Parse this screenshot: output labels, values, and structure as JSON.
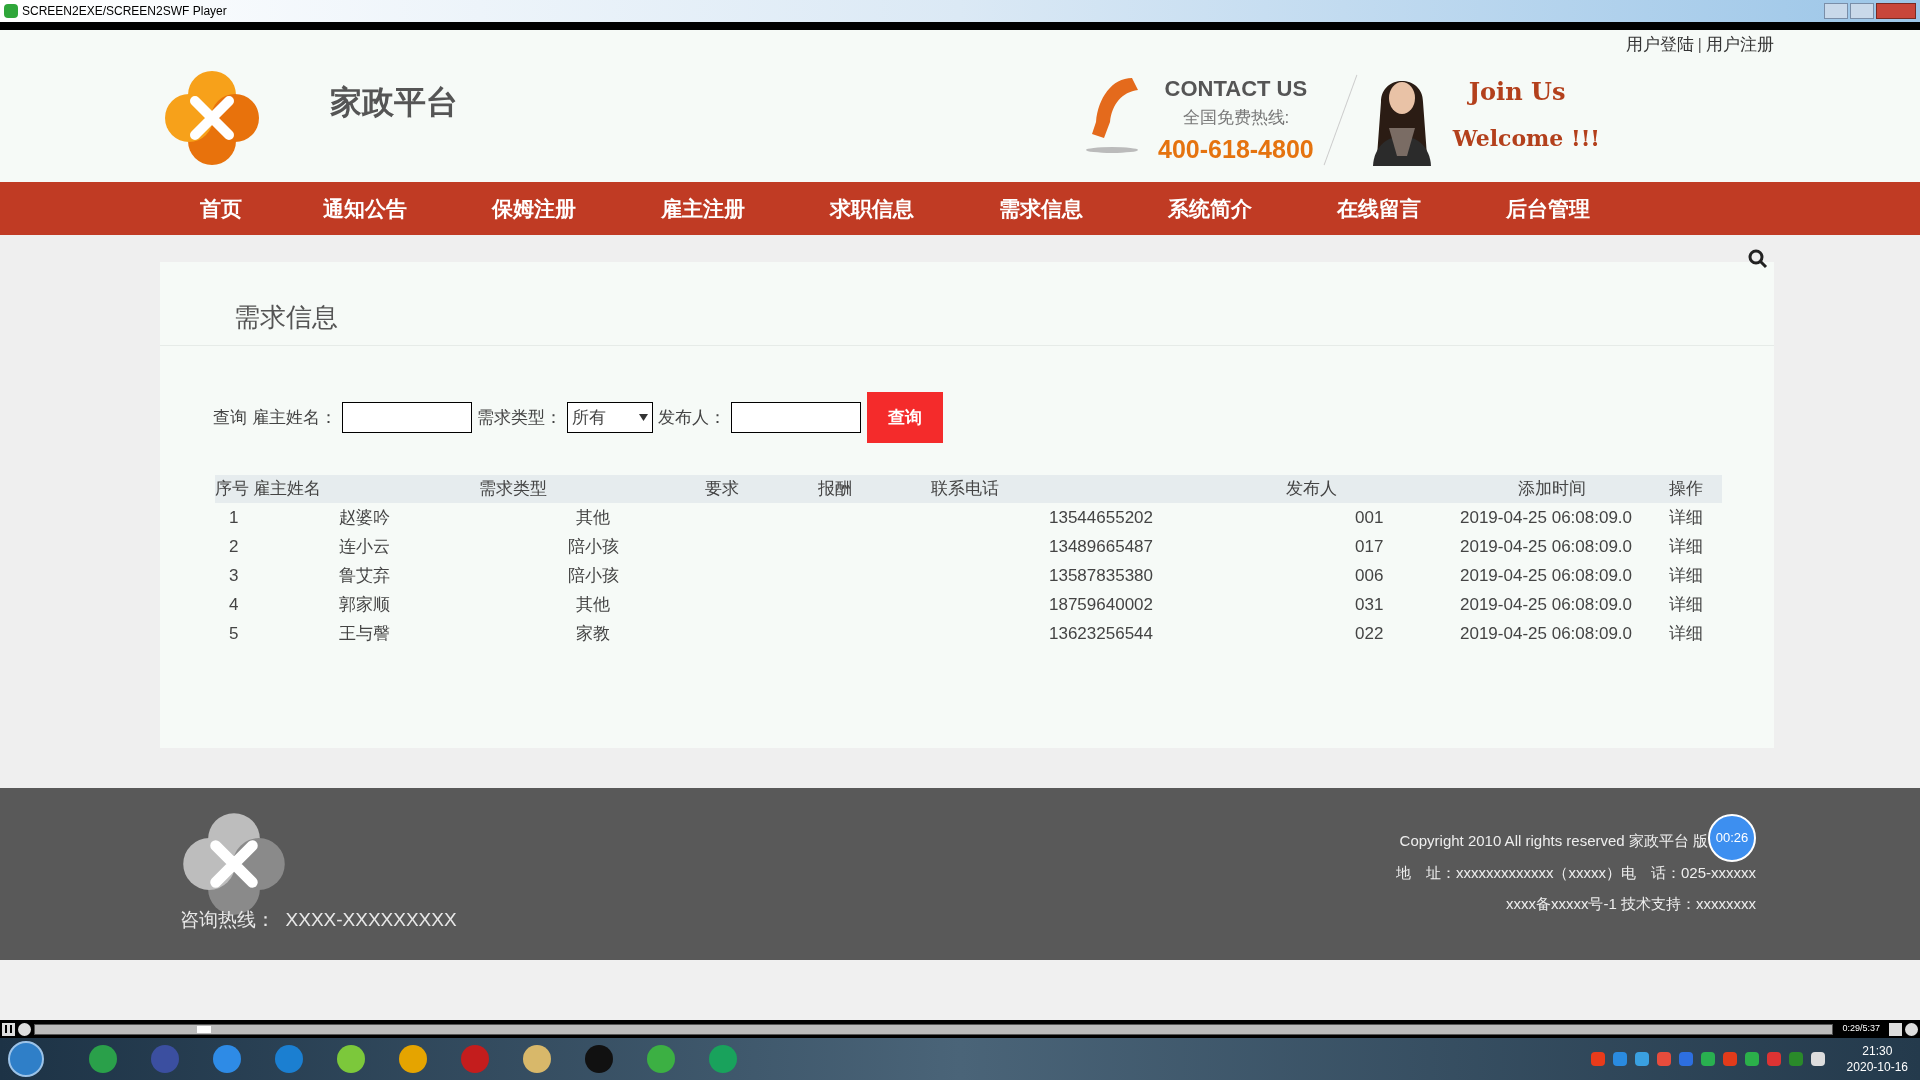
{
  "window": {
    "title": "SCREEN2EXE/SCREEN2SWF Player"
  },
  "header": {
    "user_links": [
      "用户登陆",
      "用户注册"
    ],
    "link_separator": "|",
    "site_name": "家政平台",
    "contact_title": "CONTACT US",
    "hotline_label": "全国免费热线:",
    "hotline": "400-618-4800",
    "join": "Join Us",
    "welcome": "Welcome !!!"
  },
  "nav": [
    {
      "label": "首页",
      "selected": false
    },
    {
      "label": "通知公告",
      "selected": false
    },
    {
      "label": "保姆注册",
      "selected": false
    },
    {
      "label": "雇主注册",
      "selected": false
    },
    {
      "label": "求职信息",
      "selected": false
    },
    {
      "label": "需求信息",
      "selected": false
    },
    {
      "label": "系统简介",
      "selected": false
    },
    {
      "label": "在线留言",
      "selected": false
    },
    {
      "label": "后台管理",
      "selected": false
    }
  ],
  "section_title": "需求信息",
  "search": {
    "prefix": "查询",
    "employer_label": "雇主姓名：",
    "type_label": "需求类型：",
    "type_value": "所有",
    "publisher_label": "发布人：",
    "button": "查询"
  },
  "table": {
    "columns": [
      "序号",
      "雇主姓名",
      "需求类型",
      "要求",
      "报酬",
      "联系电话",
      "发布人",
      "添加时间",
      "操作"
    ],
    "rows": [
      {
        "no": "1",
        "name": "赵婆吟",
        "type": "其他",
        "phone": "13544655202",
        "publisher": "001",
        "time": "2019-04-25 06:08:09.0",
        "action": "详细"
      },
      {
        "no": "2",
        "name": "连小云",
        "type": "陪小孩",
        "phone": "13489665487",
        "publisher": "017",
        "time": "2019-04-25 06:08:09.0",
        "action": "详细"
      },
      {
        "no": "3",
        "name": "鲁艾弃",
        "type": "陪小孩",
        "phone": "13587835380",
        "publisher": "006",
        "time": "2019-04-25 06:08:09.0",
        "action": "详细"
      },
      {
        "no": "4",
        "name": "郭家顺",
        "type": "其他",
        "phone": "18759640002",
        "publisher": "031",
        "time": "2019-04-25 06:08:09.0",
        "action": "详细"
      },
      {
        "no": "5",
        "name": "王与謦",
        "type": "家教",
        "phone": "13623256544",
        "publisher": "022",
        "time": "2019-04-25 06:08:09.0",
        "action": "详细"
      }
    ]
  },
  "footer": {
    "hotline": "咨询热线：  XXXX-XXXXXXXXX",
    "copyright": "Copyright 2010 All rights reserved 家政平台 版",
    "address": "地　址：xxxxxxxxxxxxx（xxxxx）电　话：025-xxxxxx",
    "record": "xxxx备xxxxx号-1 技术支持：xxxxxxxx",
    "timer": "00:26"
  },
  "player": {
    "level": 0.09,
    "time": "0:29/5:37"
  },
  "taskbar": {
    "time": "21:30",
    "date": "2020-10-16"
  }
}
